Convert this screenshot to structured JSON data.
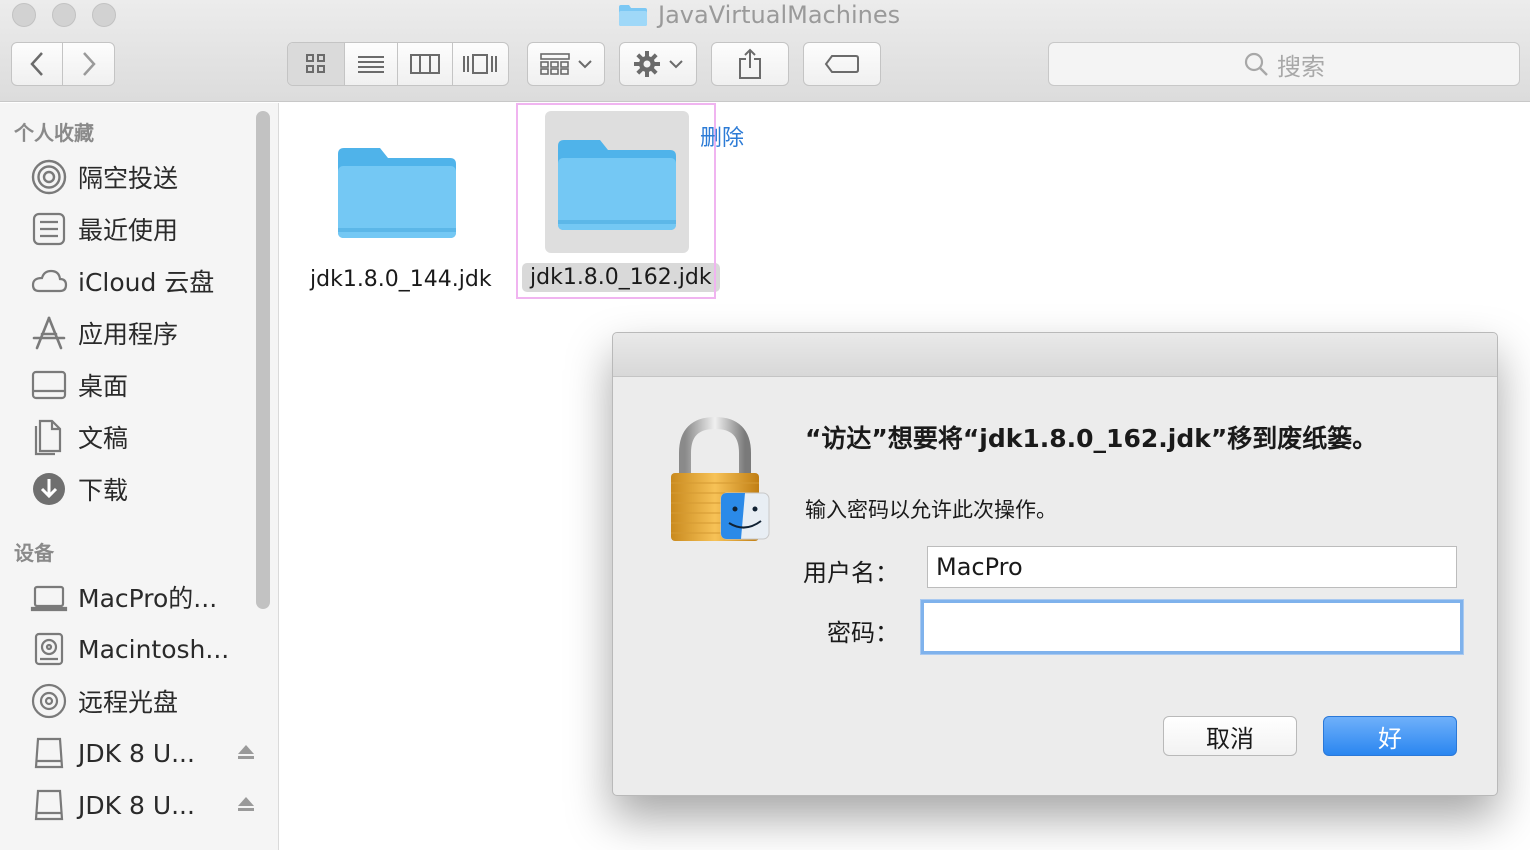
{
  "window": {
    "title": "JavaVirtualMachines",
    "traffic_lights": [
      "close",
      "minimize",
      "zoom"
    ]
  },
  "toolbar": {
    "back_icon": "chevron-left-icon",
    "forward_icon": "chevron-right-icon",
    "view_modes": [
      "icon-view",
      "list-view",
      "column-view",
      "cover-flow-view"
    ],
    "active_view": "icon-view",
    "search_placeholder": "搜索"
  },
  "sidebar": {
    "favorites_header": "个人收藏",
    "favorites": [
      {
        "label": "隔空投送",
        "icon": "airdrop-icon"
      },
      {
        "label": "最近使用",
        "icon": "recents-icon"
      },
      {
        "label": "iCloud 云盘",
        "icon": "cloud-icon"
      },
      {
        "label": "应用程序",
        "icon": "applications-icon"
      },
      {
        "label": "桌面",
        "icon": "desktop-icon"
      },
      {
        "label": "文稿",
        "icon": "documents-icon"
      },
      {
        "label": "下载",
        "icon": "downloads-icon"
      }
    ],
    "devices_header": "设备",
    "devices": [
      {
        "label": "MacPro的...",
        "icon": "laptop-icon"
      },
      {
        "label": "Macintosh...",
        "icon": "hard-drive-icon"
      },
      {
        "label": "远程光盘",
        "icon": "disc-icon"
      },
      {
        "label": "JDK 8 U...",
        "icon": "drive-icon",
        "eject": true
      },
      {
        "label": "JDK 8 U...",
        "icon": "drive-icon",
        "eject": true
      }
    ]
  },
  "files": [
    {
      "name": "jdk1.8.0_144.jdk",
      "selected": false
    },
    {
      "name": "jdk1.8.0_162.jdk",
      "selected": true
    }
  ],
  "annotation": {
    "text": "删除",
    "color": "#2c7bd6"
  },
  "dialog": {
    "title": "“访达”想要将“jdk1.8.0_162.jdk”移到废纸篓。",
    "message": "输入密码以允许此次操作。",
    "username_label": "用户名：",
    "username_value": "MacPro",
    "password_label": "密码：",
    "password_value": "",
    "cancel_label": "取消",
    "ok_label": "好"
  },
  "colors": {
    "accent": "#2a86f0",
    "folder": "#6cc3f3",
    "annotation_box": "#f0b4f0"
  }
}
